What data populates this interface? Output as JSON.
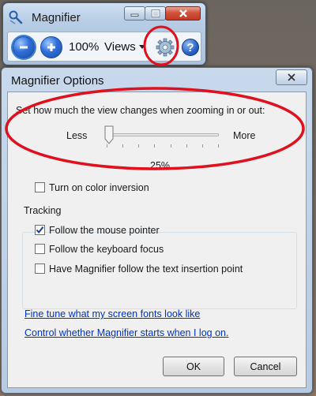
{
  "magnifier": {
    "title": "Magnifier",
    "zoom_level": "100%",
    "views_label": "Views",
    "icons": {
      "app": "magnifier-app-icon",
      "zoom_out": "minus-icon",
      "zoom_in": "plus-icon",
      "options": "gear-icon",
      "help": "help-icon"
    },
    "help_glyph": "?"
  },
  "dialog": {
    "title": "Magnifier Options",
    "zoom_prompt": "Set how much the view changes when zooming in or out:",
    "slider": {
      "min_label": "Less",
      "max_label": "More",
      "value_text": "25%",
      "level": 0.0
    },
    "color_inversion": {
      "label": "Turn on color inversion",
      "checked": false
    },
    "tracking": {
      "title": "Tracking",
      "options": [
        {
          "label": "Follow the mouse pointer",
          "checked": true
        },
        {
          "label": "Follow the keyboard focus",
          "checked": false
        },
        {
          "label": "Have Magnifier follow the text insertion point",
          "checked": false
        }
      ]
    },
    "links": [
      "Fine tune what my screen fonts look like",
      "Control whether Magnifier starts when I log on."
    ],
    "buttons": {
      "ok": "OK",
      "cancel": "Cancel"
    }
  },
  "colors": {
    "annotation": "#e0101e",
    "link": "#0033cc"
  }
}
